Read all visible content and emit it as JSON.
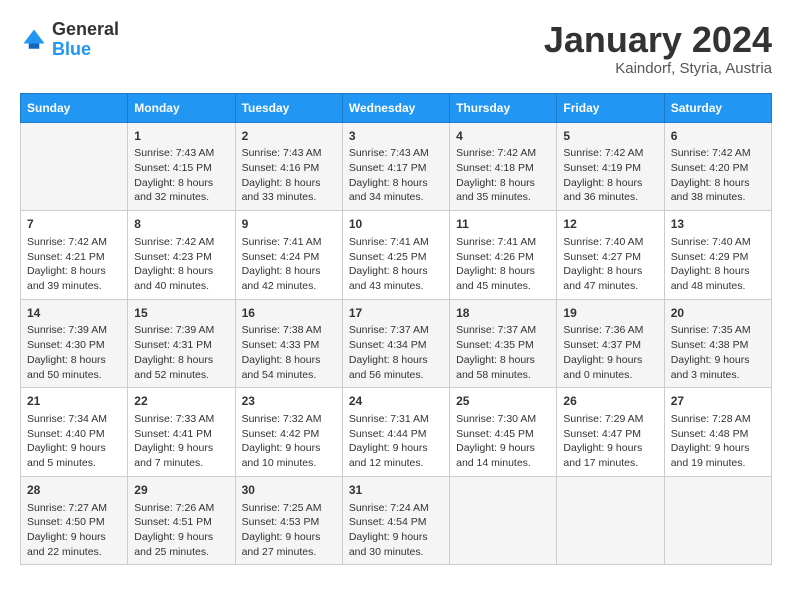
{
  "logo": {
    "line1": "General",
    "line2": "Blue"
  },
  "title": "January 2024",
  "subtitle": "Kaindorf, Styria, Austria",
  "days_of_week": [
    "Sunday",
    "Monday",
    "Tuesday",
    "Wednesday",
    "Thursday",
    "Friday",
    "Saturday"
  ],
  "weeks": [
    [
      {
        "day": null,
        "info": null
      },
      {
        "day": "1",
        "sunrise": "7:43 AM",
        "sunset": "4:15 PM",
        "daylight": "8 hours and 32 minutes."
      },
      {
        "day": "2",
        "sunrise": "7:43 AM",
        "sunset": "4:16 PM",
        "daylight": "8 hours and 33 minutes."
      },
      {
        "day": "3",
        "sunrise": "7:43 AM",
        "sunset": "4:17 PM",
        "daylight": "8 hours and 34 minutes."
      },
      {
        "day": "4",
        "sunrise": "7:42 AM",
        "sunset": "4:18 PM",
        "daylight": "8 hours and 35 minutes."
      },
      {
        "day": "5",
        "sunrise": "7:42 AM",
        "sunset": "4:19 PM",
        "daylight": "8 hours and 36 minutes."
      },
      {
        "day": "6",
        "sunrise": "7:42 AM",
        "sunset": "4:20 PM",
        "daylight": "8 hours and 38 minutes."
      }
    ],
    [
      {
        "day": "7",
        "sunrise": "7:42 AM",
        "sunset": "4:21 PM",
        "daylight": "8 hours and 39 minutes."
      },
      {
        "day": "8",
        "sunrise": "7:42 AM",
        "sunset": "4:23 PM",
        "daylight": "8 hours and 40 minutes."
      },
      {
        "day": "9",
        "sunrise": "7:41 AM",
        "sunset": "4:24 PM",
        "daylight": "8 hours and 42 minutes."
      },
      {
        "day": "10",
        "sunrise": "7:41 AM",
        "sunset": "4:25 PM",
        "daylight": "8 hours and 43 minutes."
      },
      {
        "day": "11",
        "sunrise": "7:41 AM",
        "sunset": "4:26 PM",
        "daylight": "8 hours and 45 minutes."
      },
      {
        "day": "12",
        "sunrise": "7:40 AM",
        "sunset": "4:27 PM",
        "daylight": "8 hours and 47 minutes."
      },
      {
        "day": "13",
        "sunrise": "7:40 AM",
        "sunset": "4:29 PM",
        "daylight": "8 hours and 48 minutes."
      }
    ],
    [
      {
        "day": "14",
        "sunrise": "7:39 AM",
        "sunset": "4:30 PM",
        "daylight": "8 hours and 50 minutes."
      },
      {
        "day": "15",
        "sunrise": "7:39 AM",
        "sunset": "4:31 PM",
        "daylight": "8 hours and 52 minutes."
      },
      {
        "day": "16",
        "sunrise": "7:38 AM",
        "sunset": "4:33 PM",
        "daylight": "8 hours and 54 minutes."
      },
      {
        "day": "17",
        "sunrise": "7:37 AM",
        "sunset": "4:34 PM",
        "daylight": "8 hours and 56 minutes."
      },
      {
        "day": "18",
        "sunrise": "7:37 AM",
        "sunset": "4:35 PM",
        "daylight": "8 hours and 58 minutes."
      },
      {
        "day": "19",
        "sunrise": "7:36 AM",
        "sunset": "4:37 PM",
        "daylight": "9 hours and 0 minutes."
      },
      {
        "day": "20",
        "sunrise": "7:35 AM",
        "sunset": "4:38 PM",
        "daylight": "9 hours and 3 minutes."
      }
    ],
    [
      {
        "day": "21",
        "sunrise": "7:34 AM",
        "sunset": "4:40 PM",
        "daylight": "9 hours and 5 minutes."
      },
      {
        "day": "22",
        "sunrise": "7:33 AM",
        "sunset": "4:41 PM",
        "daylight": "9 hours and 7 minutes."
      },
      {
        "day": "23",
        "sunrise": "7:32 AM",
        "sunset": "4:42 PM",
        "daylight": "9 hours and 10 minutes."
      },
      {
        "day": "24",
        "sunrise": "7:31 AM",
        "sunset": "4:44 PM",
        "daylight": "9 hours and 12 minutes."
      },
      {
        "day": "25",
        "sunrise": "7:30 AM",
        "sunset": "4:45 PM",
        "daylight": "9 hours and 14 minutes."
      },
      {
        "day": "26",
        "sunrise": "7:29 AM",
        "sunset": "4:47 PM",
        "daylight": "9 hours and 17 minutes."
      },
      {
        "day": "27",
        "sunrise": "7:28 AM",
        "sunset": "4:48 PM",
        "daylight": "9 hours and 19 minutes."
      }
    ],
    [
      {
        "day": "28",
        "sunrise": "7:27 AM",
        "sunset": "4:50 PM",
        "daylight": "9 hours and 22 minutes."
      },
      {
        "day": "29",
        "sunrise": "7:26 AM",
        "sunset": "4:51 PM",
        "daylight": "9 hours and 25 minutes."
      },
      {
        "day": "30",
        "sunrise": "7:25 AM",
        "sunset": "4:53 PM",
        "daylight": "9 hours and 27 minutes."
      },
      {
        "day": "31",
        "sunrise": "7:24 AM",
        "sunset": "4:54 PM",
        "daylight": "9 hours and 30 minutes."
      },
      {
        "day": null,
        "info": null
      },
      {
        "day": null,
        "info": null
      },
      {
        "day": null,
        "info": null
      }
    ]
  ]
}
